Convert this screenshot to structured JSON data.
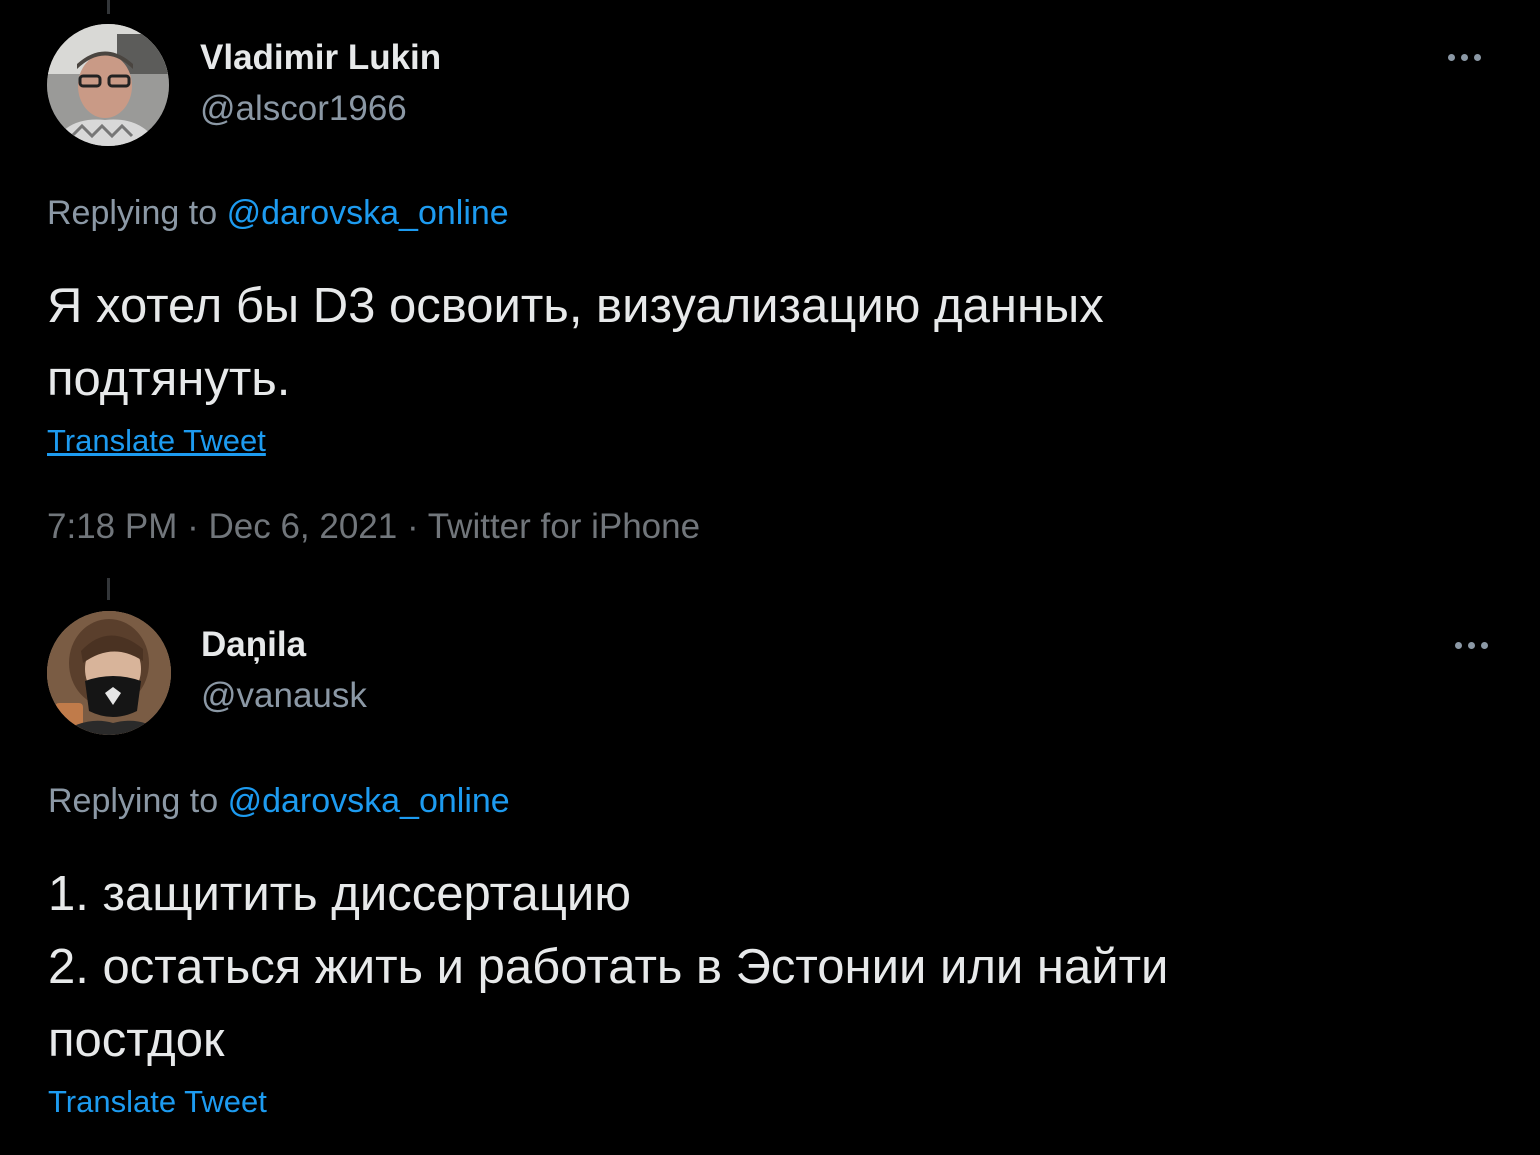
{
  "tweets": [
    {
      "display_name": "Vladimir Lukin",
      "handle": "@alscor1966",
      "avatar_icon": "avatar-photo",
      "more_icon": "more-horizontal-icon",
      "replying_prefix": "Replying to",
      "replying_to": "@darovska_online",
      "text": "Я хотел бы D3 освоить, визуализацию данных\nподтянуть.",
      "translate_label": "Translate Tweet",
      "time": "7:18 PM",
      "date": "Dec 6, 2021",
      "source": "Twitter for iPhone",
      "separator": "·"
    },
    {
      "display_name": "Daņila",
      "handle": "@vanausk",
      "avatar_icon": "avatar-photo",
      "more_icon": "more-horizontal-icon",
      "replying_prefix": "Replying to",
      "replying_to": "@darovska_online",
      "text": "1. защитить диссертацию\n2. остаться жить и работать в Эстонии или найти\nпостдок",
      "translate_label": "Translate Tweet"
    }
  ],
  "colors": {
    "background": "#000000",
    "primary_text": "#e7e9ea",
    "secondary_text": "#8b98a5",
    "link": "#1d9bf0"
  }
}
